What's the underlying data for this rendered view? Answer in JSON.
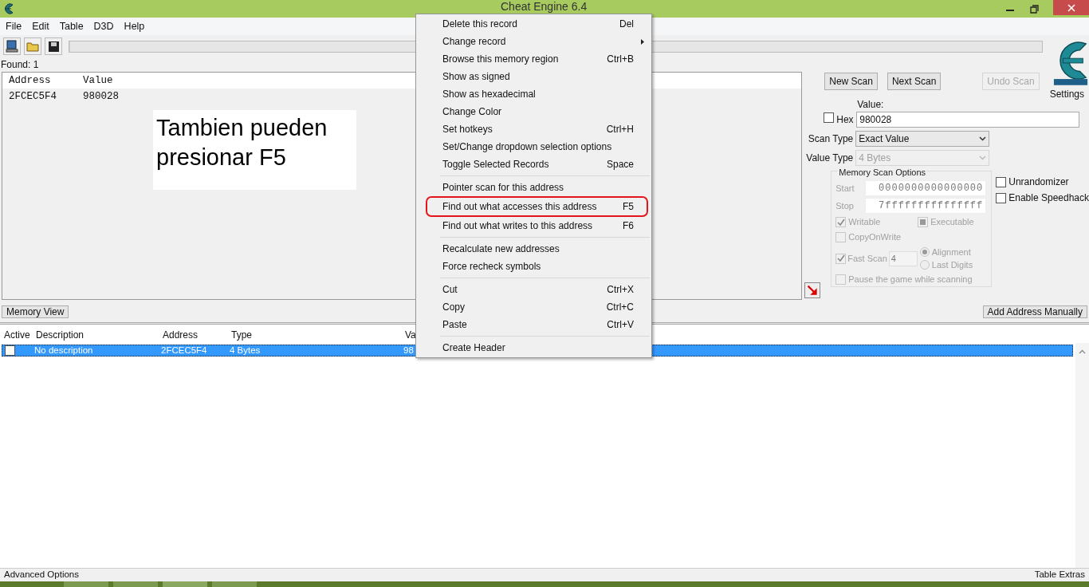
{
  "window": {
    "title": "Cheat Engine 6.4"
  },
  "menu": [
    "File",
    "Edit",
    "Table",
    "D3D",
    "Help"
  ],
  "progress": {
    "level": 0
  },
  "found": "Found: 1",
  "results": {
    "columns": [
      "Address",
      "Value"
    ],
    "rows": [
      {
        "address": "2FCEC5F4",
        "value": "980028"
      }
    ]
  },
  "annotation": "Tambien pueden presionar F5",
  "scan": {
    "buttons": [
      {
        "label": "New Scan",
        "disabled": false
      },
      {
        "label": "Next Scan",
        "disabled": false
      },
      {
        "label": "Undo Scan",
        "disabled": true
      }
    ],
    "settings": "Settings",
    "value_label": "Value:",
    "hex": {
      "label": "Hex",
      "checked": false
    },
    "value": "980028",
    "scan_type": {
      "label": "Scan Type",
      "value": "Exact Value",
      "disabled": false
    },
    "value_type": {
      "label": "Value Type",
      "value": "4 Bytes",
      "disabled": true
    },
    "memory_options": {
      "title": "Memory Scan Options",
      "disabled": true,
      "start_label": "Start",
      "start": "0000000000000000",
      "stop_label": "Stop",
      "stop": "7fffffffffffffff",
      "writable": {
        "label": "Writable",
        "checked": true
      },
      "executable": {
        "label": "Executable",
        "indeterminate": true
      },
      "copy_on_write": {
        "label": "CopyOnWrite",
        "checked": false
      },
      "fast_scan": {
        "label": "Fast Scan",
        "checked": true,
        "value": "4"
      },
      "radios": [
        {
          "label": "Alignment",
          "selected": true
        },
        {
          "label": "Last Digits",
          "selected": false
        }
      ],
      "pause": {
        "label": "Pause the game while scanning",
        "checked": false
      }
    },
    "unrandomizer": {
      "label": "Unrandomizer",
      "checked": false
    },
    "speedhack": {
      "label": "Enable Speedhack",
      "checked": false
    }
  },
  "memory_view": "Memory View",
  "add_address": "Add Address Manually",
  "table": {
    "columns": [
      "Active",
      "Description",
      "Address",
      "Type",
      "Va"
    ],
    "rows": [
      {
        "active": false,
        "description": "No description",
        "address": "2FCEC5F4",
        "type": "4 Bytes",
        "value": "98",
        "selected": true
      }
    ]
  },
  "context_menu": {
    "groups": [
      [
        {
          "label": "Delete this record",
          "shortcut": "Del",
          "submenu": false,
          "circled": false
        },
        {
          "label": "Change record",
          "submenu": true,
          "circled": false
        },
        {
          "label": "Browse this memory region",
          "shortcut": "Ctrl+B",
          "submenu": false,
          "circled": false
        },
        {
          "label": "Show as signed",
          "submenu": false,
          "circled": false
        },
        {
          "label": "Show as hexadecimal",
          "submenu": false,
          "circled": false
        },
        {
          "label": "Change Color",
          "submenu": false,
          "circled": false
        },
        {
          "label": "Set hotkeys",
          "shortcut": "Ctrl+H",
          "submenu": false,
          "circled": false
        },
        {
          "label": "Set/Change dropdown selection options",
          "submenu": false,
          "circled": false
        },
        {
          "label": "Toggle Selected Records",
          "shortcut": "Space",
          "submenu": false,
          "circled": false
        }
      ],
      [
        {
          "label": "Pointer scan for this address",
          "submenu": false,
          "circled": false
        },
        {
          "label": "Find out what accesses this address",
          "shortcut": "F5",
          "submenu": false,
          "circled": true
        },
        {
          "label": "Find out what writes to this address",
          "shortcut": "F6",
          "submenu": false,
          "circled": false
        }
      ],
      [
        {
          "label": "Recalculate new addresses",
          "submenu": false,
          "circled": false
        },
        {
          "label": "Force recheck symbols",
          "submenu": false,
          "circled": false
        }
      ],
      [
        {
          "label": "Cut",
          "shortcut": "Ctrl+X",
          "submenu": false,
          "circled": false
        },
        {
          "label": "Copy",
          "shortcut": "Ctrl+C",
          "submenu": false,
          "circled": false
        },
        {
          "label": "Paste",
          "shortcut": "Ctrl+V",
          "submenu": false,
          "circled": false
        }
      ],
      [
        {
          "label": "Create Header",
          "submenu": false,
          "circled": false
        }
      ]
    ]
  },
  "status": {
    "left": "Advanced Options",
    "right": "Table Extras"
  }
}
